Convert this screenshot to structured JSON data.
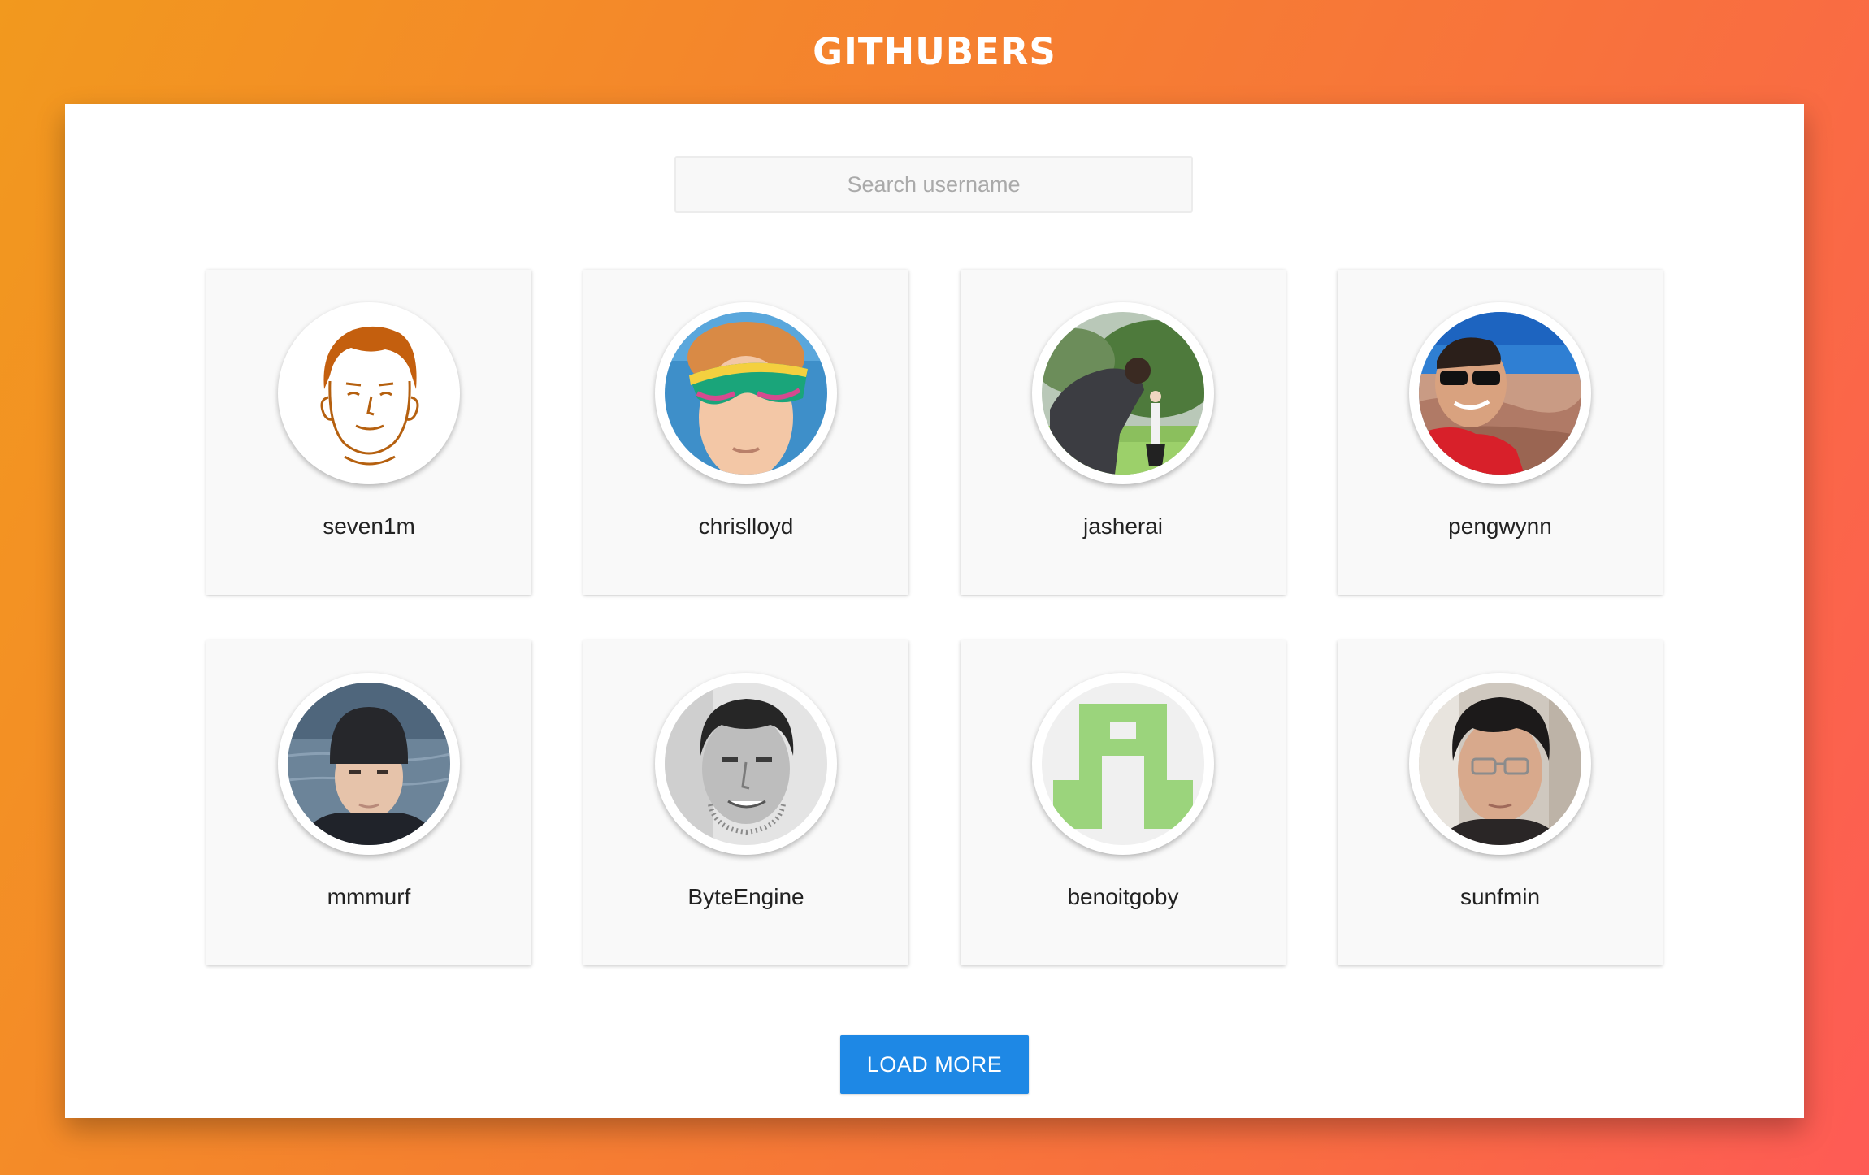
{
  "app": {
    "title": "GITHUBERS"
  },
  "search": {
    "placeholder": "Search username",
    "value": ""
  },
  "users": [
    {
      "username": "seven1m",
      "avatar": "cartoon-face"
    },
    {
      "username": "chrislloyd",
      "avatar": "kid-sunglasses-photo"
    },
    {
      "username": "jasherai",
      "avatar": "outdoor-photo"
    },
    {
      "username": "pengwynn",
      "avatar": "canyon-sunglasses-photo"
    },
    {
      "username": "mmmurf",
      "avatar": "beanie-photo"
    },
    {
      "username": "ByteEngine",
      "avatar": "bw-portrait-photo"
    },
    {
      "username": "benoitgoby",
      "avatar": "identicon"
    },
    {
      "username": "sunfmin",
      "avatar": "glasses-portrait-photo"
    }
  ],
  "actions": {
    "load_more_label": "LOAD MORE"
  },
  "colors": {
    "background_gradient_start": "#f2991e",
    "background_gradient_end": "#fe5b55",
    "button_blue": "#1e88e5",
    "identicon_green": "#9bd47c"
  }
}
